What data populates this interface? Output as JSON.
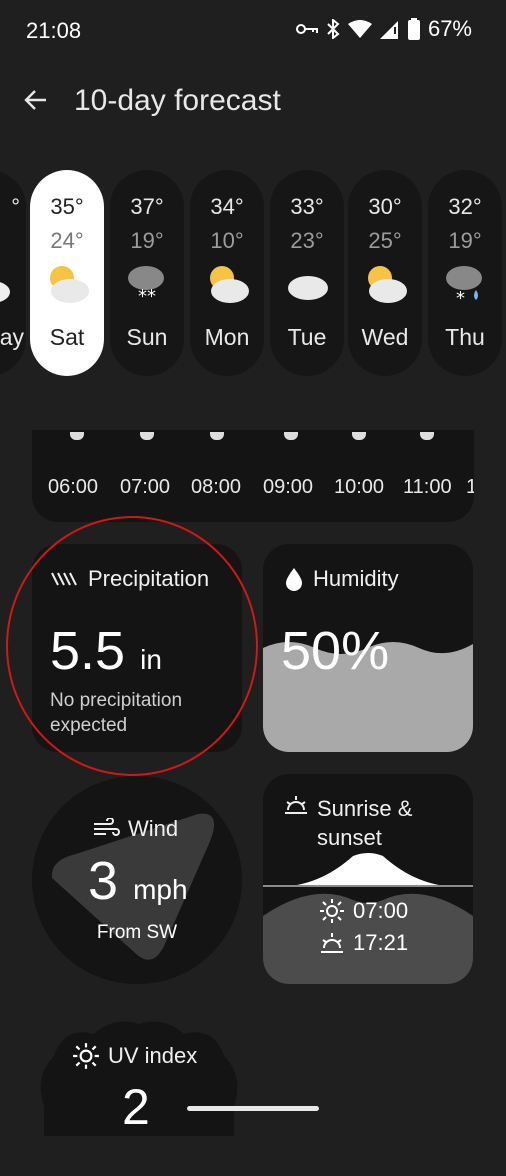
{
  "status": {
    "time": "21:08",
    "battery": "67%"
  },
  "appbar": {
    "title": "10-day forecast"
  },
  "days": [
    {
      "name": "ay",
      "hi": "°",
      "lo": "°",
      "icon": "partly-cloudy-icon"
    },
    {
      "name": "Sat",
      "hi": "35°",
      "lo": "24°",
      "icon": "partly-cloudy-icon"
    },
    {
      "name": "Sun",
      "hi": "37°",
      "lo": "19°",
      "icon": "snow-cloud-icon"
    },
    {
      "name": "Mon",
      "hi": "34°",
      "lo": "10°",
      "icon": "partly-cloudy-icon"
    },
    {
      "name": "Tue",
      "hi": "33°",
      "lo": "23°",
      "icon": "cloud-icon"
    },
    {
      "name": "Wed",
      "hi": "30°",
      "lo": "25°",
      "icon": "partly-cloudy-icon"
    },
    {
      "name": "Thu",
      "hi": "32°",
      "lo": "19°",
      "icon": "sleet-cloud-icon"
    }
  ],
  "hourly": {
    "times": [
      "06:00",
      "07:00",
      "08:00",
      "09:00",
      "10:00",
      "11:00",
      "1"
    ]
  },
  "precipitation": {
    "title": "Precipitation",
    "value": "5.5",
    "unit": "in",
    "caption_line1": "No precipitation",
    "caption_line2": "expected"
  },
  "humidity": {
    "title": "Humidity",
    "value": "50%",
    "level": 0.5
  },
  "wind": {
    "title": "Wind",
    "value": "3",
    "unit": "mph",
    "direction": "From SW"
  },
  "sun": {
    "title_line1": "Sunrise &",
    "title_line2": "sunset",
    "sunrise": "07:00",
    "sunset": "17:21"
  },
  "uv": {
    "title": "UV index",
    "value": "2"
  },
  "colors": {
    "background": "#1f1f1f",
    "card": "#141414",
    "selected": "#ffffff",
    "annotation": "#d01818"
  }
}
